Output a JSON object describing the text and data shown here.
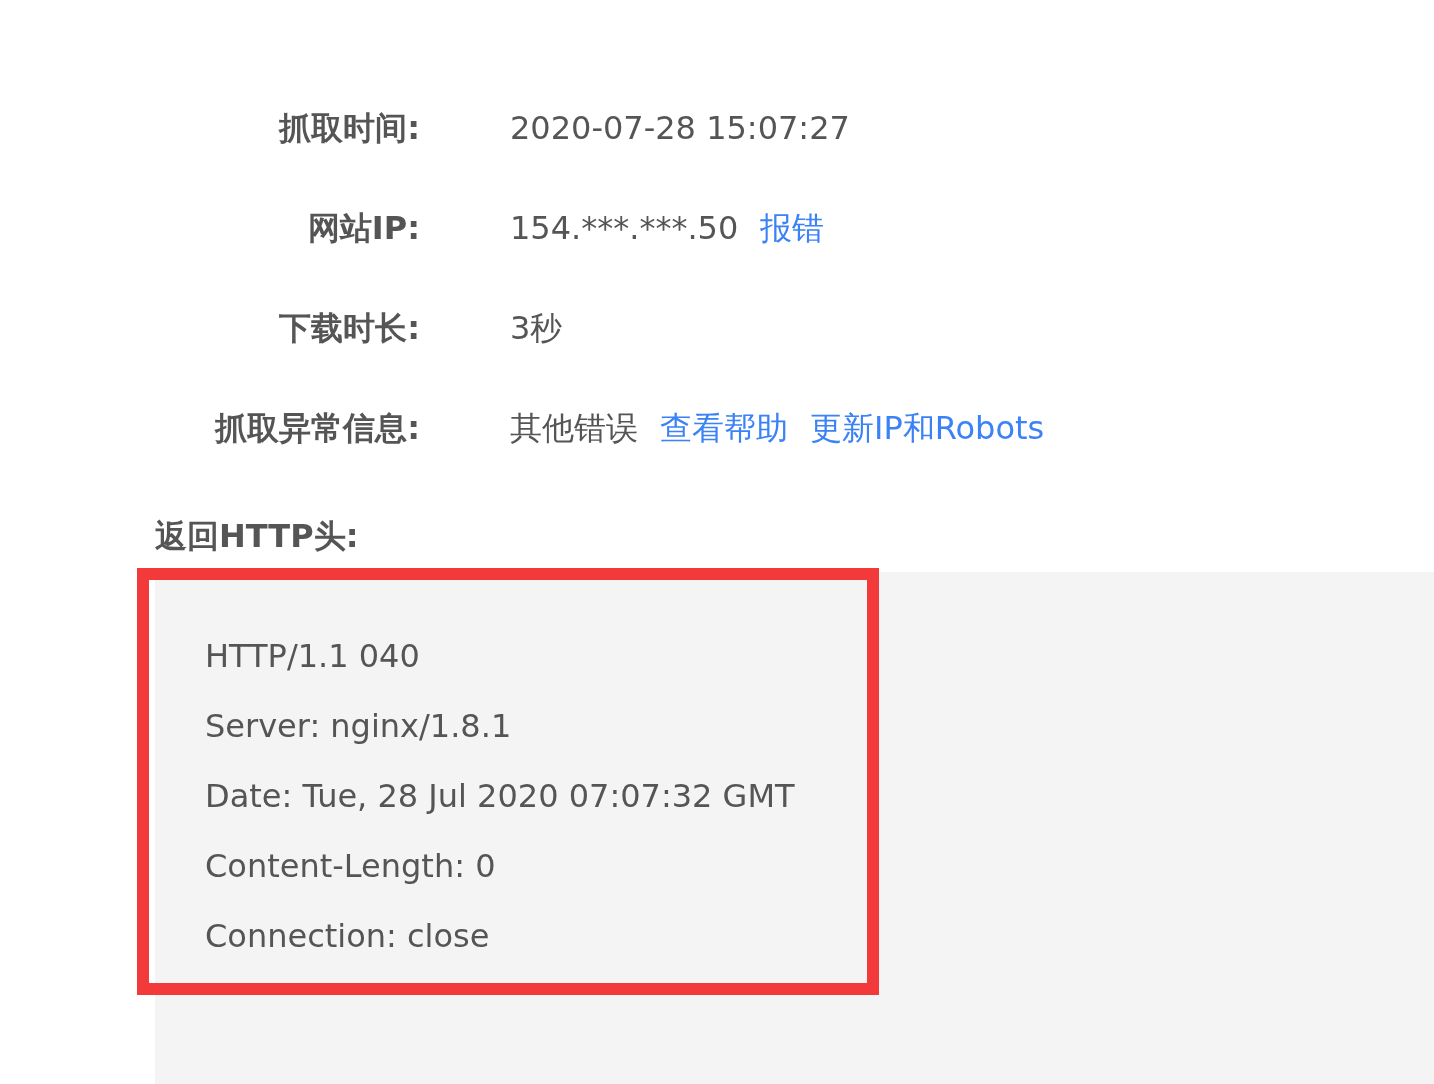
{
  "fields": [
    {
      "label": "抓取时间:",
      "parts": [
        {
          "kind": "text",
          "text": "2020-07-28 15:07:27"
        }
      ]
    },
    {
      "label": "网站IP:",
      "parts": [
        {
          "kind": "text",
          "text": "154.***.***.50"
        },
        {
          "kind": "link",
          "text": "报错"
        }
      ]
    },
    {
      "label": "下载时长:",
      "parts": [
        {
          "kind": "text",
          "text": "3秒"
        }
      ]
    },
    {
      "label": "抓取异常信息:",
      "parts": [
        {
          "kind": "text",
          "text": "其他错误"
        },
        {
          "kind": "link",
          "text": "查看帮助"
        },
        {
          "kind": "link",
          "text": "更新IP和Robots"
        }
      ]
    }
  ],
  "http_header": {
    "title": "返回HTTP头:",
    "highlighted": true,
    "lines": [
      "HTTP/1.1 040",
      "Server: nginx/1.8.1",
      "Date: Tue, 28 Jul 2020 07:07:32 GMT",
      "Content-Length: 0",
      "Connection: close"
    ]
  }
}
